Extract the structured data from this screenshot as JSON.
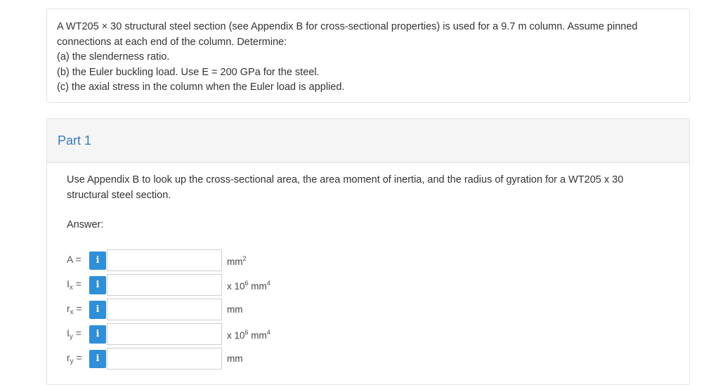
{
  "problem": {
    "line1": "A WT205 × 30 structural steel section (see Appendix B for cross-sectional properties) is used for a 9.7 m column. Assume pinned",
    "line2": "connections at each end of the column. Determine:",
    "line3": "(a) the slenderness ratio.",
    "line4": "(b) the Euler buckling load. Use E = 200 GPa for the steel.",
    "line5": "(c) the axial stress in the column when the Euler load is applied."
  },
  "part": {
    "title": "Part 1",
    "instruction_line1": "Use Appendix B to look up the cross-sectional area, the area moment of inertia, and the radius of gyration for a WT205 x 30",
    "instruction_line2": "structural steel section.",
    "answer_label": "Answer:"
  },
  "answers": [
    {
      "var": "A",
      "sub": "",
      "eq": " =",
      "info": "i",
      "value": "",
      "unit_main": "mm",
      "unit_sup": "2",
      "unit_after": ""
    },
    {
      "var": "I",
      "sub": "x",
      "eq": " =",
      "info": "i",
      "value": "",
      "unit_main": "x 10",
      "unit_sup": "6",
      "unit_after": " mm",
      "unit_sup2": "4"
    },
    {
      "var": "r",
      "sub": "x",
      "eq": " =",
      "info": "i",
      "value": "",
      "unit_main": "mm",
      "unit_sup": "",
      "unit_after": ""
    },
    {
      "var": "I",
      "sub": "y",
      "eq": " =",
      "info": "i",
      "value": "",
      "unit_main": "x 10",
      "unit_sup": "6",
      "unit_after": " mm",
      "unit_sup2": "4"
    },
    {
      "var": "r",
      "sub": "y",
      "eq": " =",
      "info": "i",
      "value": "",
      "unit_main": "mm",
      "unit_sup": "",
      "unit_after": ""
    }
  ],
  "colors": {
    "accent": "#3a7ab8",
    "info_button": "#2f8fd8"
  }
}
